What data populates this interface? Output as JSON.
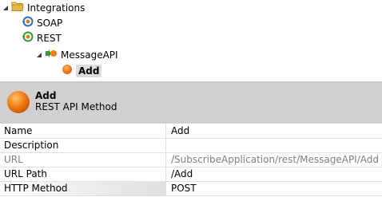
{
  "tree": {
    "integrations_label": "Integrations",
    "soap_label": "SOAP",
    "rest_label": "REST",
    "messageapi_label": "MessageAPI",
    "add_label": "Add"
  },
  "header": {
    "title": "Add",
    "subtitle": "REST API Method"
  },
  "properties": [
    {
      "name": "Name",
      "value": "Add"
    },
    {
      "name": "Description",
      "value": ""
    },
    {
      "name": "URL",
      "value": "/SubscribeApplication/rest/MessageAPI/Add"
    },
    {
      "name": "URL Path",
      "value": "/Add"
    },
    {
      "name": "HTTP Method",
      "value": "POST"
    }
  ],
  "colors": {
    "folder": "#e8b84a",
    "soap_ring": "#2a6fc9",
    "rest_ring": "#2e9e3e",
    "method_orange": "#f07a10",
    "header_bg": "#d0d0d0"
  }
}
